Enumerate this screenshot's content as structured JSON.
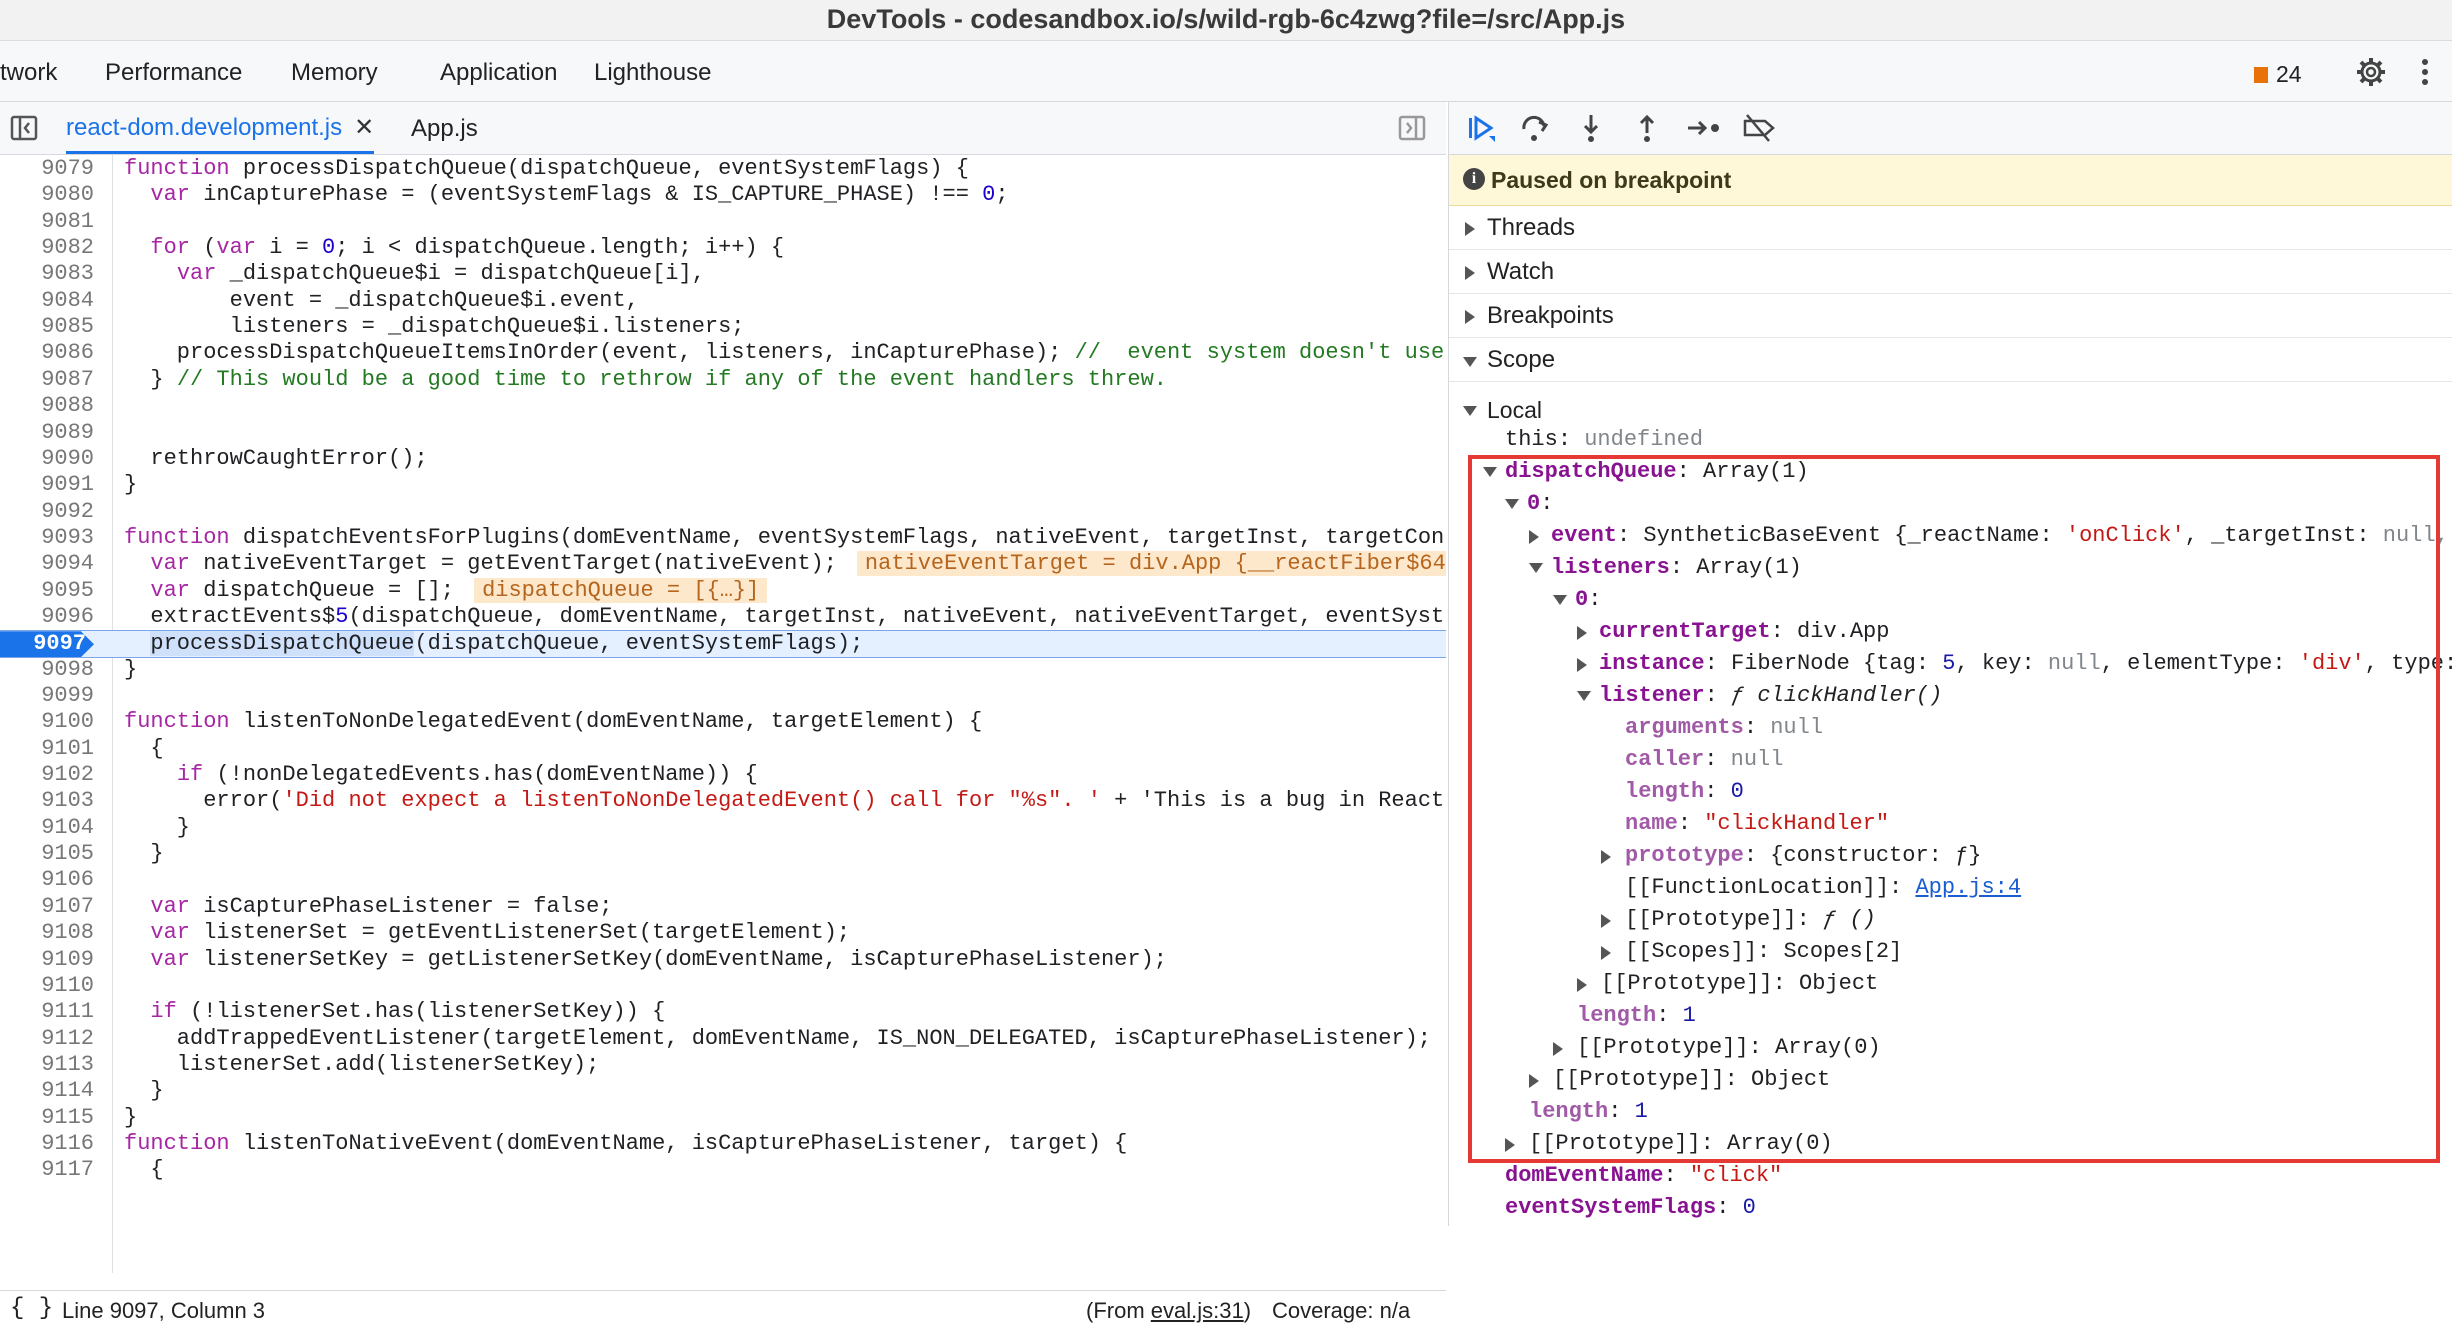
{
  "window": {
    "title": "DevTools - codesandbox.io/s/wild-rgb-6c4zwg?file=/src/App.js"
  },
  "panel_tabs": [
    "twork",
    "Performance",
    "Memory",
    "Application",
    "Lighthouse"
  ],
  "issues_count": "24",
  "file_tabs": {
    "active": "react-dom.development.js",
    "other": "App.js"
  },
  "code_lines": [
    {
      "n": "9079",
      "t": "function processDispatchQueue(dispatchQueue, eventSystemFlags) {"
    },
    {
      "n": "9080",
      "t": "  var inCapturePhase = (eventSystemFlags & IS_CAPTURE_PHASE) !== 0;"
    },
    {
      "n": "9081",
      "t": ""
    },
    {
      "n": "9082",
      "t": "  for (var i = 0; i < dispatchQueue.length; i++) {"
    },
    {
      "n": "9083",
      "t": "    var _dispatchQueue$i = dispatchQueue[i],"
    },
    {
      "n": "9084",
      "t": "        event = _dispatchQueue$i.event,"
    },
    {
      "n": "9085",
      "t": "        listeners = _dispatchQueue$i.listeners;"
    },
    {
      "n": "9086",
      "t": "    processDispatchQueueItemsInOrder(event, listeners, inCapturePhase); //  event system doesn't use"
    },
    {
      "n": "9087",
      "t": "  } // This would be a good time to rethrow if any of the event handlers threw."
    },
    {
      "n": "9088",
      "t": ""
    },
    {
      "n": "9089",
      "t": ""
    },
    {
      "n": "9090",
      "t": "  rethrowCaughtError();"
    },
    {
      "n": "9091",
      "t": "}"
    },
    {
      "n": "9092",
      "t": ""
    },
    {
      "n": "9093",
      "t": "function dispatchEventsForPlugins(domEventName, eventSystemFlags, nativeEvent, targetInst, targetCon"
    },
    {
      "n": "9094",
      "t": "  var nativeEventTarget = getEventTarget(nativeEvent);"
    },
    {
      "n": "9095",
      "t": "  var dispatchQueue = [];"
    },
    {
      "n": "9096",
      "t": "  extractEvents$5(dispatchQueue, domEventName, targetInst, nativeEvent, nativeEventTarget, eventSyst"
    },
    {
      "n": "9097",
      "t": "  processDispatchQueue(dispatchQueue, eventSystemFlags);"
    },
    {
      "n": "9098",
      "t": "}"
    },
    {
      "n": "9099",
      "t": ""
    },
    {
      "n": "9100",
      "t": "function listenToNonDelegatedEvent(domEventName, targetElement) {"
    },
    {
      "n": "9101",
      "t": "  {"
    },
    {
      "n": "9102",
      "t": "    if (!nonDelegatedEvents.has(domEventName)) {"
    },
    {
      "n": "9103",
      "t": "      error('Did not expect a listenToNonDelegatedEvent() call for \"%s\". ' + 'This is a bug in React"
    },
    {
      "n": "9104",
      "t": "    }"
    },
    {
      "n": "9105",
      "t": "  }"
    },
    {
      "n": "9106",
      "t": ""
    },
    {
      "n": "9107",
      "t": "  var isCapturePhaseListener = false;"
    },
    {
      "n": "9108",
      "t": "  var listenerSet = getEventListenerSet(targetElement);"
    },
    {
      "n": "9109",
      "t": "  var listenerSetKey = getListenerSetKey(domEventName, isCapturePhaseListener);"
    },
    {
      "n": "9110",
      "t": ""
    },
    {
      "n": "9111",
      "t": "  if (!listenerSet.has(listenerSetKey)) {"
    },
    {
      "n": "9112",
      "t": "    addTrappedEventListener(targetElement, domEventName, IS_NON_DELEGATED, isCapturePhaseListener);"
    },
    {
      "n": "9113",
      "t": "    listenerSet.add(listenerSetKey);"
    },
    {
      "n": "9114",
      "t": "  }"
    },
    {
      "n": "9115",
      "t": "}"
    },
    {
      "n": "9116",
      "t": "function listenToNativeEvent(domEventName, isCapturePhaseListener, target) {"
    },
    {
      "n": "9117",
      "t": "  {"
    }
  ],
  "inline_values": {
    "native_event_target": "nativeEventTarget = div.App {__reactFiber$64",
    "dispatch_queue": "dispatchQueue = [{…}]"
  },
  "breakpoint_line": "9097",
  "status": {
    "position": "Line 9097, Column 3",
    "from_prefix": "(From ",
    "from_link": "eval.js:31",
    "from_suffix": ")",
    "coverage": "Coverage: n/a"
  },
  "paused_message": "Paused on breakpoint",
  "sections": [
    "Threads",
    "Watch",
    "Breakpoints",
    "Scope"
  ],
  "scope": {
    "local_label": "Local",
    "this_key": "this",
    "this_val": "undefined",
    "dispatchQueue_key": "dispatchQueue",
    "dispatchQueue_val": "Array(1)",
    "idx0": "0",
    "event_key": "event",
    "event_val_pre": "SyntheticBaseEvent {_reactName: ",
    "event_val_str": "'onClick'",
    "event_val_post": ", _targetInst: ",
    "event_val_null": "null,",
    "listeners_key": "listeners",
    "listeners_val": "Array(1)",
    "li0": "0",
    "currentTarget_key": "currentTarget",
    "currentTarget_val": "div.App",
    "instance_key": "instance",
    "instance_val_pre": "FiberNode {tag: ",
    "instance_num": "5",
    "instance_mid": ", key: ",
    "instance_null": "null",
    "instance_mid2": ", elementType: ",
    "instance_str": "'div'",
    "instance_post": ", type:",
    "listener_key": "listener",
    "listener_val": "ƒ clickHandler()",
    "arguments_key": "arguments",
    "arguments_val": "null",
    "caller_key": "caller",
    "caller_val": "null",
    "length_key": "length",
    "length_val": "0",
    "name_key": "name",
    "name_val": "\"clickHandler\"",
    "prototype_key": "prototype",
    "prototype_val": "{constructor: ƒ}",
    "fnloc_key": "[[FunctionLocation]]",
    "fnloc_val": "App.js:4",
    "proto_fn_key": "[[Prototype]]",
    "proto_fn_val": "ƒ ()",
    "scopes_key": "[[Scopes]]",
    "scopes_val": "Scopes[2]",
    "proto_obj_key": "[[Prototype]]",
    "proto_obj_val": "Object",
    "l_length_key": "length",
    "l_length_val": "1",
    "l_proto_key": "[[Prototype]]",
    "l_proto_val": "Array(0)",
    "i0_proto_key": "[[Prototype]]",
    "i0_proto_val": "Object",
    "dq_length_key": "length",
    "dq_length_val": "1",
    "dq_proto_key": "[[Prototype]]",
    "dq_proto_val": "Array(0)",
    "domEventName_key": "domEventName",
    "domEventName_val": "\"click\"",
    "eventSystemFlags_key": "eventSystemFlags",
    "eventSystemFlags_val": "0"
  },
  "colors": {
    "accent": "#1a73e8",
    "highlight_box": "#e53935",
    "paused_bg": "#fef8d9"
  }
}
